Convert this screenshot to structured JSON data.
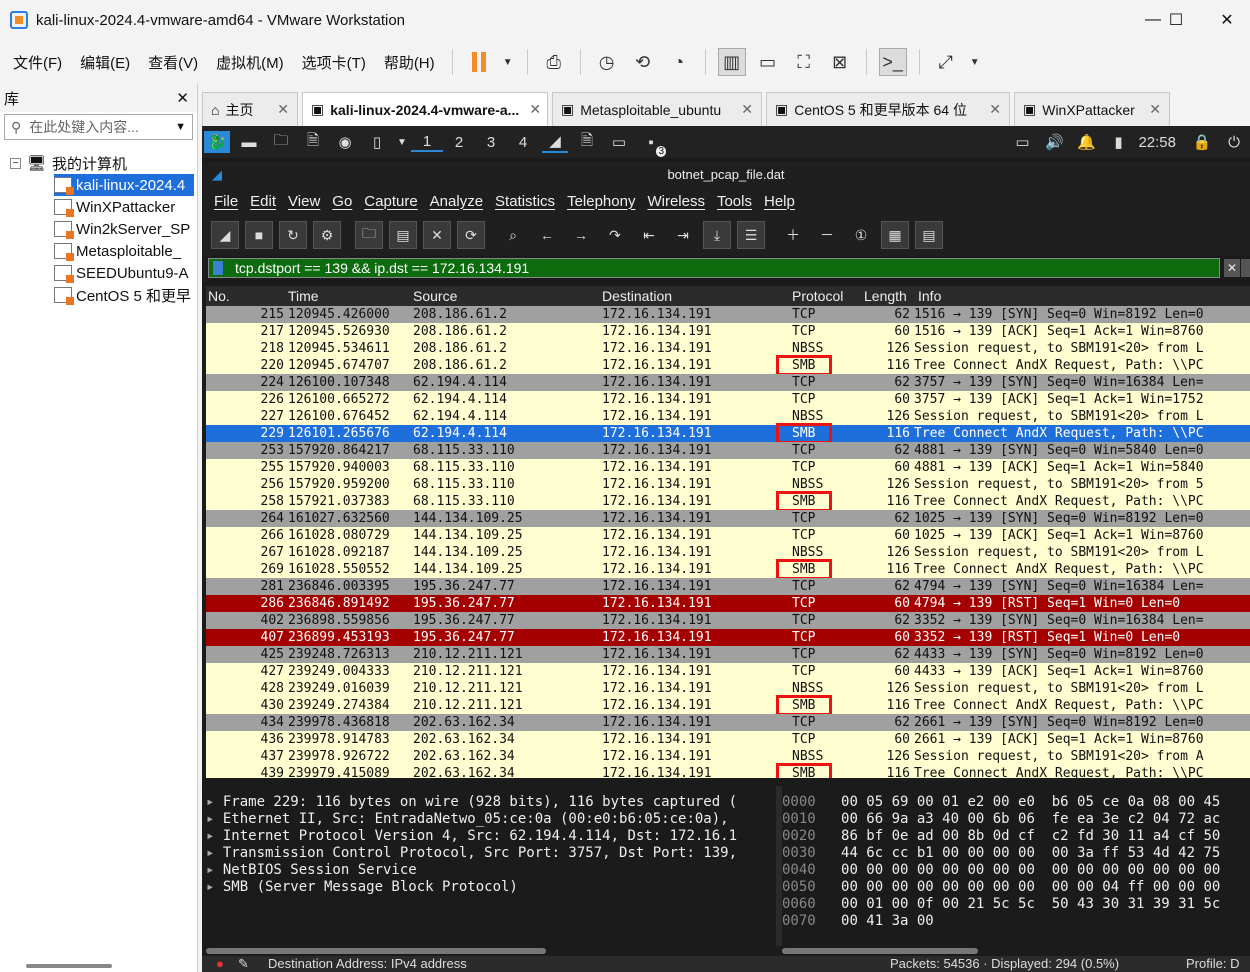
{
  "window": {
    "title": "kali-linux-2024.4-vmware-amd64 - VMware Workstation",
    "controls": [
      "minimize-icon",
      "maximize-icon",
      "close-icon"
    ]
  },
  "menubar": [
    "文件(F)",
    "编辑(E)",
    "查看(V)",
    "虚拟机(M)",
    "选项卡(T)",
    "帮助(H)"
  ],
  "library": {
    "title": "库",
    "search_placeholder": "在此处键入内容...",
    "root": "我的计算机",
    "vms": [
      "kali-linux-2024.4",
      "WinXPattacker",
      "Win2kServer_SP",
      "Metasploitable_",
      "SEEDUbuntu9-A",
      "CentOS 5 和更早"
    ]
  },
  "tabs": [
    {
      "label": "主页",
      "active": false
    },
    {
      "label": "kali-linux-2024.4-vmware-a...",
      "active": true
    },
    {
      "label": "Metasploitable_ubuntu",
      "active": false
    },
    {
      "label": "CentOS 5 和更早版本 64 位",
      "active": false
    },
    {
      "label": "WinXPattacker",
      "active": false
    }
  ],
  "kali_panel": {
    "workspaces": [
      "1",
      "2",
      "3",
      "4"
    ],
    "active_workspace": "1",
    "badge": "3",
    "clock": "22:58"
  },
  "wireshark": {
    "title": "botnet_pcap_file.dat",
    "menu": [
      "File",
      "Edit",
      "View",
      "Go",
      "Capture",
      "Analyze",
      "Statistics",
      "Telephony",
      "Wireless",
      "Tools",
      "Help"
    ],
    "filter": "tcp.dstport == 139 && ip.dst == 172.16.134.191",
    "columns": [
      "No.",
      "Time",
      "Source",
      "Destination",
      "Protocol",
      "Length",
      "Info"
    ],
    "packets": [
      {
        "no": "215",
        "time": "120945.426000",
        "src": "208.186.61.2",
        "dst": "172.16.134.191",
        "proto": "TCP",
        "len": "62",
        "info": "1516 → 139 [SYN] Seq=0 Win=8192 Len=0",
        "color": "syn"
      },
      {
        "no": "217",
        "time": "120945.526930",
        "src": "208.186.61.2",
        "dst": "172.16.134.191",
        "proto": "TCP",
        "len": "60",
        "info": "1516 → 139 [ACK] Seq=1 Ack=1 Win=8760",
        "color": "smb"
      },
      {
        "no": "218",
        "time": "120945.534611",
        "src": "208.186.61.2",
        "dst": "172.16.134.191",
        "proto": "NBSS",
        "len": "126",
        "info": "Session request, to SBM191<20> from L",
        "color": "smb"
      },
      {
        "no": "220",
        "time": "120945.674707",
        "src": "208.186.61.2",
        "dst": "172.16.134.191",
        "proto": "SMB",
        "len": "116",
        "info": "Tree Connect AndX Request, Path: \\\\PC",
        "color": "smb"
      },
      {
        "no": "224",
        "time": "126100.107348",
        "src": "62.194.4.114",
        "dst": "172.16.134.191",
        "proto": "TCP",
        "len": "62",
        "info": "3757 → 139 [SYN] Seq=0 Win=16384 Len=",
        "color": "syn"
      },
      {
        "no": "226",
        "time": "126100.665272",
        "src": "62.194.4.114",
        "dst": "172.16.134.191",
        "proto": "TCP",
        "len": "60",
        "info": "3757 → 139 [ACK] Seq=1 Ack=1 Win=1752",
        "color": "smb"
      },
      {
        "no": "227",
        "time": "126100.676452",
        "src": "62.194.4.114",
        "dst": "172.16.134.191",
        "proto": "NBSS",
        "len": "126",
        "info": "Session request, to SBM191<20> from L",
        "color": "smb"
      },
      {
        "no": "229",
        "time": "126101.265676",
        "src": "62.194.4.114",
        "dst": "172.16.134.191",
        "proto": "SMB",
        "len": "116",
        "info": "Tree Connect AndX Request, Path: \\\\PC",
        "color": "sel"
      },
      {
        "no": "253",
        "time": "157920.864217",
        "src": "68.115.33.110",
        "dst": "172.16.134.191",
        "proto": "TCP",
        "len": "62",
        "info": "4881 → 139 [SYN] Seq=0 Win=5840 Len=0",
        "color": "syn"
      },
      {
        "no": "255",
        "time": "157920.940003",
        "src": "68.115.33.110",
        "dst": "172.16.134.191",
        "proto": "TCP",
        "len": "60",
        "info": "4881 → 139 [ACK] Seq=1 Ack=1 Win=5840",
        "color": "smb"
      },
      {
        "no": "256",
        "time": "157920.959200",
        "src": "68.115.33.110",
        "dst": "172.16.134.191",
        "proto": "NBSS",
        "len": "126",
        "info": "Session request, to SBM191<20> from 5",
        "color": "smb"
      },
      {
        "no": "258",
        "time": "157921.037383",
        "src": "68.115.33.110",
        "dst": "172.16.134.191",
        "proto": "SMB",
        "len": "116",
        "info": "Tree Connect AndX Request, Path: \\\\PC",
        "color": "smb"
      },
      {
        "no": "264",
        "time": "161027.632560",
        "src": "144.134.109.25",
        "dst": "172.16.134.191",
        "proto": "TCP",
        "len": "62",
        "info": "1025 → 139 [SYN] Seq=0 Win=8192 Len=0",
        "color": "syn"
      },
      {
        "no": "266",
        "time": "161028.080729",
        "src": "144.134.109.25",
        "dst": "172.16.134.191",
        "proto": "TCP",
        "len": "60",
        "info": "1025 → 139 [ACK] Seq=1 Ack=1 Win=8760",
        "color": "smb"
      },
      {
        "no": "267",
        "time": "161028.092187",
        "src": "144.134.109.25",
        "dst": "172.16.134.191",
        "proto": "NBSS",
        "len": "126",
        "info": "Session request, to SBM191<20> from L",
        "color": "smb"
      },
      {
        "no": "269",
        "time": "161028.550552",
        "src": "144.134.109.25",
        "dst": "172.16.134.191",
        "proto": "SMB",
        "len": "116",
        "info": "Tree Connect AndX Request, Path: \\\\PC",
        "color": "smb"
      },
      {
        "no": "281",
        "time": "236846.003395",
        "src": "195.36.247.77",
        "dst": "172.16.134.191",
        "proto": "TCP",
        "len": "62",
        "info": "4794 → 139 [SYN] Seq=0 Win=16384 Len=",
        "color": "syn"
      },
      {
        "no": "286",
        "time": "236846.891492",
        "src": "195.36.247.77",
        "dst": "172.16.134.191",
        "proto": "TCP",
        "len": "60",
        "info": "4794 → 139 [RST] Seq=1 Win=0 Len=0",
        "color": "rst"
      },
      {
        "no": "402",
        "time": "236898.559856",
        "src": "195.36.247.77",
        "dst": "172.16.134.191",
        "proto": "TCP",
        "len": "62",
        "info": "3352 → 139 [SYN] Seq=0 Win=16384 Len=",
        "color": "syn"
      },
      {
        "no": "407",
        "time": "236899.453193",
        "src": "195.36.247.77",
        "dst": "172.16.134.191",
        "proto": "TCP",
        "len": "60",
        "info": "3352 → 139 [RST] Seq=1 Win=0 Len=0",
        "color": "rst"
      },
      {
        "no": "425",
        "time": "239248.726313",
        "src": "210.12.211.121",
        "dst": "172.16.134.191",
        "proto": "TCP",
        "len": "62",
        "info": "4433 → 139 [SYN] Seq=0 Win=8192 Len=0",
        "color": "syn"
      },
      {
        "no": "427",
        "time": "239249.004333",
        "src": "210.12.211.121",
        "dst": "172.16.134.191",
        "proto": "TCP",
        "len": "60",
        "info": "4433 → 139 [ACK] Seq=1 Ack=1 Win=8760",
        "color": "smb"
      },
      {
        "no": "428",
        "time": "239249.016039",
        "src": "210.12.211.121",
        "dst": "172.16.134.191",
        "proto": "NBSS",
        "len": "126",
        "info": "Session request, to SBM191<20> from L",
        "color": "smb"
      },
      {
        "no": "430",
        "time": "239249.274384",
        "src": "210.12.211.121",
        "dst": "172.16.134.191",
        "proto": "SMB",
        "len": "116",
        "info": "Tree Connect AndX Request, Path: \\\\PC",
        "color": "smb"
      },
      {
        "no": "434",
        "time": "239978.436818",
        "src": "202.63.162.34",
        "dst": "172.16.134.191",
        "proto": "TCP",
        "len": "62",
        "info": "2661 → 139 [SYN] Seq=0 Win=8192 Len=0",
        "color": "syn"
      },
      {
        "no": "436",
        "time": "239978.914783",
        "src": "202.63.162.34",
        "dst": "172.16.134.191",
        "proto": "TCP",
        "len": "60",
        "info": "2661 → 139 [ACK] Seq=1 Ack=1 Win=8760",
        "color": "smb"
      },
      {
        "no": "437",
        "time": "239978.926722",
        "src": "202.63.162.34",
        "dst": "172.16.134.191",
        "proto": "NBSS",
        "len": "126",
        "info": "Session request, to SBM191<20> from A",
        "color": "smb"
      },
      {
        "no": "439",
        "time": "239979.415089",
        "src": "202.63.162.34",
        "dst": "172.16.134.191",
        "proto": "SMB",
        "len": "116",
        "info": "Tree Connect AndX Request, Path: \\\\PC",
        "color": "smb"
      }
    ],
    "details": [
      "Frame 229: 116 bytes on wire (928 bits), 116 bytes captured (",
      "Ethernet II, Src: EntradaNetwo_05:ce:0a (00:e0:b6:05:ce:0a),",
      "Internet Protocol Version 4, Src: 62.194.4.114, Dst: 172.16.1",
      "Transmission Control Protocol, Src Port: 3757, Dst Port: 139,",
      "NetBIOS Session Service",
      "SMB (Server Message Block Protocol)"
    ],
    "hex": [
      {
        "off": "0000",
        "bytes": "00 05 69 00 01 e2 00 e0  b6 05 ce 0a 08 00 45"
      },
      {
        "off": "0010",
        "bytes": "00 66 9a a3 40 00 6b 06  fe ea 3e c2 04 72 ac"
      },
      {
        "off": "0020",
        "bytes": "86 bf 0e ad 00 8b 0d cf  c2 fd 30 11 a4 cf 50"
      },
      {
        "off": "0030",
        "bytes": "44 6c cc b1 00 00 00 00  00 3a ff 53 4d 42 75"
      },
      {
        "off": "0040",
        "bytes": "00 00 00 00 00 00 00 00  00 00 00 00 00 00 00"
      },
      {
        "off": "0050",
        "bytes": "00 00 00 00 00 00 00 00  00 00 04 ff 00 00 00"
      },
      {
        "off": "0060",
        "bytes": "00 01 00 0f 00 21 5c 5c  50 43 30 31 39 31 5c"
      },
      {
        "off": "0070",
        "bytes": "00 41 3a 00"
      }
    ],
    "status": {
      "field": "Destination Address: IPv4 address",
      "packets": "Packets: 54536 · Displayed: 294 (0.5%)",
      "profile": "Profile: D"
    }
  }
}
